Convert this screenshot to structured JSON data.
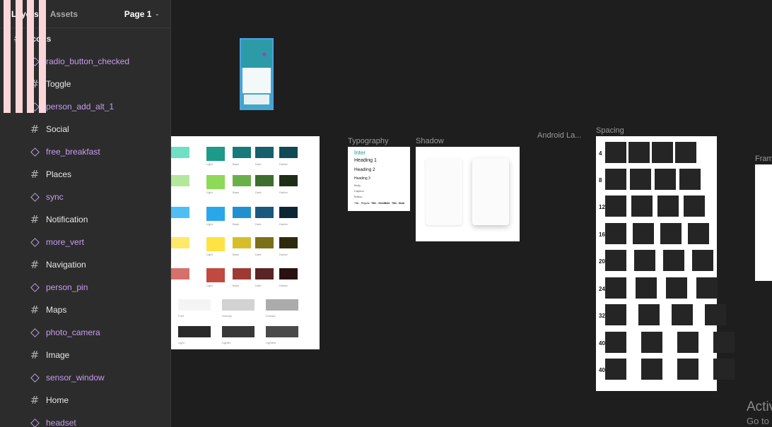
{
  "panel": {
    "tabs": [
      {
        "label": "Layers"
      },
      {
        "label": "Assets"
      }
    ],
    "page_selector": "Page 1",
    "root": {
      "label": "Icons",
      "type": "frame"
    },
    "items": [
      {
        "label": "radio_button_checked",
        "type": "component"
      },
      {
        "label": "Toggle",
        "type": "frame"
      },
      {
        "label": "person_add_alt_1",
        "type": "component"
      },
      {
        "label": "Social",
        "type": "frame"
      },
      {
        "label": "free_breakfast",
        "type": "component"
      },
      {
        "label": "Places",
        "type": "frame"
      },
      {
        "label": "sync",
        "type": "component"
      },
      {
        "label": "Notification",
        "type": "frame"
      },
      {
        "label": "more_vert",
        "type": "component"
      },
      {
        "label": "Navigation",
        "type": "frame"
      },
      {
        "label": "person_pin",
        "type": "component"
      },
      {
        "label": "Maps",
        "type": "frame"
      },
      {
        "label": "photo_camera",
        "type": "component"
      },
      {
        "label": "Image",
        "type": "frame"
      },
      {
        "label": "sensor_window",
        "type": "component"
      },
      {
        "label": "Home",
        "type": "frame"
      },
      {
        "label": "headset",
        "type": "component"
      }
    ]
  },
  "canvas": {
    "frames": {
      "typography": "Typography",
      "shadow": "Shadow",
      "android": "Android La...",
      "spacing": "Spacing",
      "partial": "Fram"
    },
    "palette": {
      "rows": [
        [
          "#6fe0c4",
          "#1e9a8a",
          "#177a7a",
          "#15606a",
          "#0f4a56"
        ],
        [
          "#b3e89a",
          "#8ed85a",
          "#6ab04a",
          "#3f6e2c",
          "#1f2e16"
        ],
        [
          "#4ebff5",
          "#2aa6ea",
          "#2090d0",
          "#1a5880",
          "#0e2536"
        ],
        [
          "#ffe86a",
          "#ffe244",
          "#d6be2a",
          "#7a7018",
          "#2e2a10"
        ],
        [
          "#d6706a",
          "#c14a40",
          "#9e3a34",
          "#5a2424",
          "#2a1010"
        ]
      ],
      "row_labels": [
        "Light",
        "Base",
        "Dark",
        "Darker",
        "Darkest"
      ],
      "neutral_rows": [
        [
          "#f4f4f4",
          "#d2d2d2",
          "#ababab"
        ],
        [
          "#2a2a2a",
          "#383838",
          "#4a4a4a"
        ]
      ],
      "neutral_labels": [
        [
          "Pure",
          "Overlay",
          "Surface"
        ],
        [
          "Light",
          "Lighter",
          "Lightest"
        ]
      ]
    },
    "typography": {
      "font": "Inter",
      "h1": "Heading 1",
      "h2": "Heading 2",
      "h3": "Heading 3",
      "body": "Body",
      "caption": "Caption",
      "button": "Button",
      "footer_a": "Title - Regular",
      "footer_b": "Title - SemiBold",
      "footer_c": "Title - Bold"
    },
    "spacing": {
      "labels": [
        "4",
        "8",
        "12",
        "16",
        "20",
        "24",
        "32",
        "40",
        "40"
      ]
    },
    "watermark": {
      "title": "Activ",
      "subtitle": "Go to"
    }
  },
  "colors": {
    "panel_bg": "#2c2c2c",
    "canvas_bg": "#1e1e1e",
    "component_label": "#c79cf0",
    "selection": "#4aa2e0"
  }
}
